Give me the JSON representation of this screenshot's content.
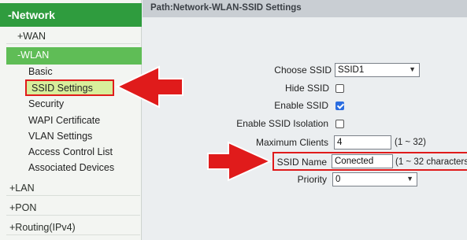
{
  "sidebar": {
    "header": "-Network",
    "items": [
      {
        "label": "+WAN"
      },
      {
        "label": "-WLAN"
      },
      {
        "label": "+LAN"
      },
      {
        "label": "+PON"
      },
      {
        "label": "+Routing(IPv4)"
      }
    ],
    "wlan_subitems": [
      {
        "label": "Basic"
      },
      {
        "label": "SSID Settings",
        "active": true
      },
      {
        "label": "Security"
      },
      {
        "label": "WAPI Certificate"
      },
      {
        "label": "VLAN Settings"
      },
      {
        "label": "Access Control List"
      },
      {
        "label": "Associated Devices"
      }
    ]
  },
  "main": {
    "path": "Path:Network-WLAN-SSID Settings",
    "form": {
      "choose_ssid": {
        "label": "Choose SSID",
        "value": "SSID1"
      },
      "hide_ssid": {
        "label": "Hide SSID",
        "checked": false
      },
      "enable_ssid": {
        "label": "Enable SSID",
        "checked": true
      },
      "enable_ssid_isolation": {
        "label": "Enable SSID Isolation",
        "checked": false
      },
      "maximum_clients": {
        "label": "Maximum Clients",
        "value": "4",
        "hint": "(1 ~ 32)"
      },
      "ssid_name": {
        "label": "SSID Name",
        "value": "Conected",
        "hint": "(1 ~ 32 characters"
      },
      "priority": {
        "label": "Priority",
        "value": "0"
      }
    }
  },
  "colors": {
    "accent_green": "#2f9c3e",
    "active_item_bg": "#d8ee9b",
    "highlight_red": "#e01b1b",
    "checkbox_blue": "#2b6de0"
  }
}
